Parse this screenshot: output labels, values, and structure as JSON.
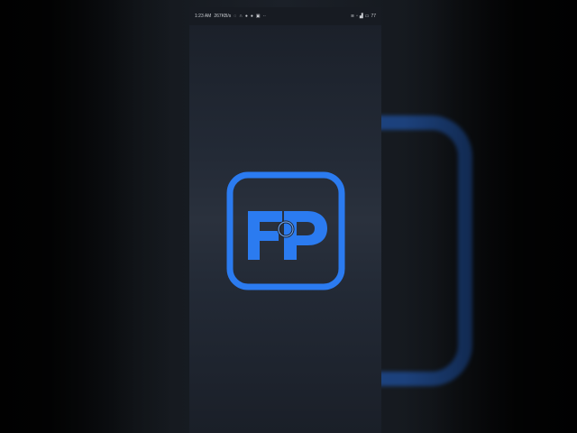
{
  "status_bar": {
    "time": "1:23 AM",
    "speed": "267KB/s",
    "left_icons": [
      "shield-icon",
      "headset-icon",
      "whatsapp-icon",
      "chrome-icon",
      "gallery-icon",
      "more-dots-icon"
    ],
    "right_icons": [
      "wifi-icon",
      "alarm-icon",
      "signal-icon",
      "battery-icon"
    ],
    "battery": "77"
  },
  "logo": {
    "text": "FP",
    "brand_color": "#2b7bf0",
    "bg_color": "#1a1f28"
  }
}
